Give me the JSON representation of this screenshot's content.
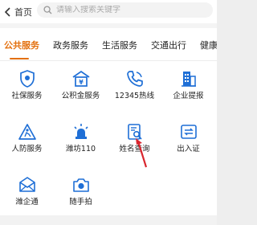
{
  "header": {
    "back_label": "首页",
    "search_placeholder": "请输入搜索关键字",
    "search_value": ""
  },
  "tabs": [
    {
      "label": "公共服务",
      "active": true
    },
    {
      "label": "政务服务",
      "active": false
    },
    {
      "label": "生活服务",
      "active": false
    },
    {
      "label": "交通出行",
      "active": false
    },
    {
      "label": "健康医",
      "active": false
    }
  ],
  "services": [
    {
      "label": "社保服务",
      "icon": "shield-icon"
    },
    {
      "label": "公积金服务",
      "icon": "housing-fund-icon"
    },
    {
      "label": "12345热线",
      "icon": "phone-icon"
    },
    {
      "label": "企业提报",
      "icon": "building-icon"
    },
    {
      "label": "人防服务",
      "icon": "civil-defense-icon"
    },
    {
      "label": "潍坊110",
      "icon": "police-siren-icon"
    },
    {
      "label": "姓名查询",
      "icon": "name-search-icon"
    },
    {
      "label": "出入证",
      "icon": "pass-card-icon"
    },
    {
      "label": "潍企通",
      "icon": "envelope-icon"
    },
    {
      "label": "随手拍",
      "icon": "camera-icon"
    }
  ],
  "colors": {
    "accent": "#e3700e",
    "icon_blue": "#1f6fd6",
    "annotation_arrow": "#d9262e"
  }
}
